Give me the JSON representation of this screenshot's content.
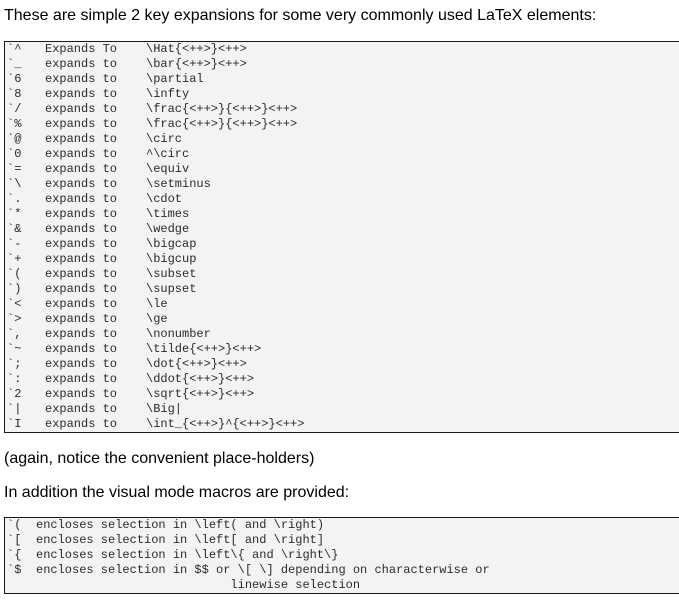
{
  "intro": "These are simple 2 key expansions for some very commonly used LaTeX elements:",
  "expansions": [
    {
      "key": "`^",
      "mid": "Expands To",
      "value": "\\Hat{<++>}<++>"
    },
    {
      "key": "`_",
      "mid": "expands to",
      "value": "\\bar{<++>}<++>"
    },
    {
      "key": "`6",
      "mid": "expands to",
      "value": "\\partial"
    },
    {
      "key": "`8",
      "mid": "expands to",
      "value": "\\infty"
    },
    {
      "key": "`/",
      "mid": "expands to",
      "value": "\\frac{<++>}{<++>}<++>"
    },
    {
      "key": "`%",
      "mid": "expands to",
      "value": "\\frac{<++>}{<++>}<++>"
    },
    {
      "key": "`@",
      "mid": "expands to",
      "value": "\\circ"
    },
    {
      "key": "`0",
      "mid": "expands to",
      "value": "^\\circ"
    },
    {
      "key": "`=",
      "mid": "expands to",
      "value": "\\equiv"
    },
    {
      "key": "`\\",
      "mid": "expands to",
      "value": "\\setminus"
    },
    {
      "key": "`.",
      "mid": "expands to",
      "value": "\\cdot"
    },
    {
      "key": "`*",
      "mid": "expands to",
      "value": "\\times"
    },
    {
      "key": "`&",
      "mid": "expands to",
      "value": "\\wedge"
    },
    {
      "key": "`-",
      "mid": "expands to",
      "value": "\\bigcap"
    },
    {
      "key": "`+",
      "mid": "expands to",
      "value": "\\bigcup"
    },
    {
      "key": "`(",
      "mid": "expands to",
      "value": "\\subset"
    },
    {
      "key": "`)",
      "mid": "expands to",
      "value": "\\supset"
    },
    {
      "key": "`<",
      "mid": "expands to",
      "value": "\\le"
    },
    {
      "key": "`>",
      "mid": "expands to",
      "value": "\\ge"
    },
    {
      "key": "`,",
      "mid": "expands to",
      "value": "\\nonumber"
    },
    {
      "key": "`~",
      "mid": "expands to",
      "value": "\\tilde{<++>}<++>"
    },
    {
      "key": "`;",
      "mid": "expands to",
      "value": "\\dot{<++>}<++>"
    },
    {
      "key": "`:",
      "mid": "expands to",
      "value": "\\ddot{<++>}<++>"
    },
    {
      "key": "`2",
      "mid": "expands to",
      "value": "\\sqrt{<++>}<++>"
    },
    {
      "key": "`|",
      "mid": "expands to",
      "value": "\\Big|"
    },
    {
      "key": "`I",
      "mid": "expands to",
      "value": "\\int_{<++>}^{<++>}<++>"
    }
  ],
  "again": "(again, notice the convenient place-holders)",
  "visual_intro": "In addition the visual mode macros are provided:",
  "visual": [
    {
      "key": "`(",
      "text": "encloses selection in \\left( and \\right)"
    },
    {
      "key": "`[",
      "text": "encloses selection in \\left[ and \\right]"
    },
    {
      "key": "`{",
      "text": "encloses selection in \\left\\{ and \\right\\}"
    },
    {
      "key": "`$",
      "text": "encloses selection in $$ or \\[ \\] depending on characterwise or"
    },
    {
      "key": "",
      "text": "                           linewise selection"
    }
  ]
}
